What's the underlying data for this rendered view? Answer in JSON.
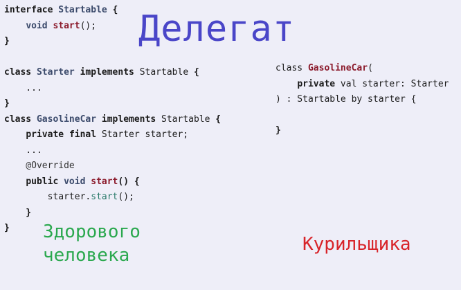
{
  "title": "Делегат",
  "left_code": {
    "interface_block": {
      "kw_interface": "interface",
      "iface_name": "Startable",
      "brace_open": " {",
      "indent": "    ",
      "kw_void": "void",
      "method_start": "start",
      "method_tail": "();",
      "brace_close": "}"
    },
    "starter_block": {
      "kw_class": "class",
      "class_name": "Starter",
      "kw_implements": "implements",
      "iface_name": "Startable",
      "brace_open": " {",
      "ellipsis": "    ...",
      "brace_close": "}"
    },
    "car_block": {
      "kw_class": "class",
      "class_name": "GasolineCar",
      "kw_implements": "implements",
      "iface_name": "Startable",
      "brace_open": " {",
      "indent": "    ",
      "kw_private": "private",
      "kw_final": "final",
      "field_decl": " Starter starter;",
      "ellipsis": "    ...",
      "annotation": "    @Override",
      "kw_public": "public",
      "kw_void": "void",
      "method_start": "start",
      "method_sig_tail": "() {",
      "call_indent": "        ",
      "call_receiver": "starter.",
      "call_method": "start",
      "call_tail": "();",
      "inner_close": "    }",
      "brace_close": "}"
    }
  },
  "right_code": {
    "kw_class": "class",
    "class_name": "GasolineCar",
    "paren_open": "(",
    "indent": "    ",
    "kw_private": "private",
    "param_decl": " val starter: Starter",
    "tail": ") : Startable by starter {",
    "brace_close": "}"
  },
  "label_healthy_line1": "Здорового",
  "label_healthy_line2": "человека",
  "label_smoker": "Курильщика"
}
